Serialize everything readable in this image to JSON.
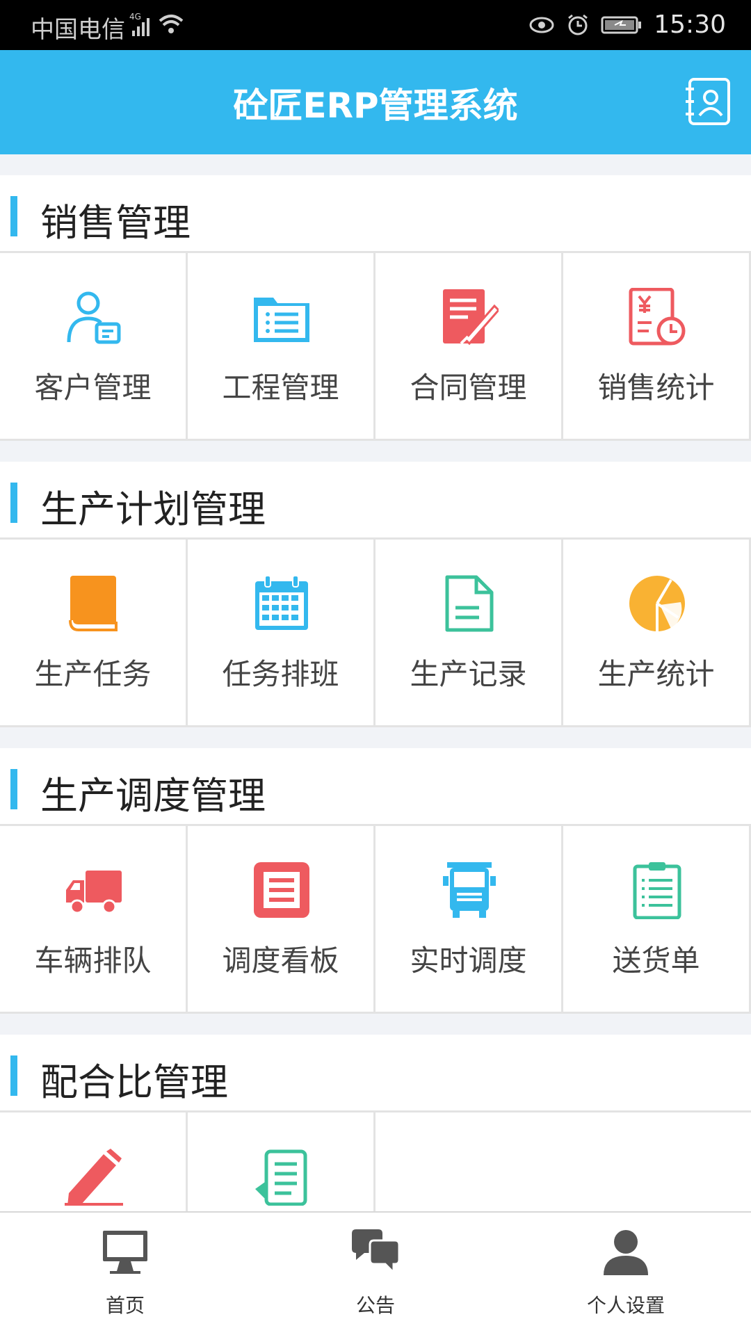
{
  "status_bar": {
    "carrier": "中国电信",
    "network": "4G",
    "time": "15:30"
  },
  "header": {
    "title": "砼匠ERP管理系统",
    "right_icon": "contacts-icon"
  },
  "sections": [
    {
      "title": "销售管理",
      "items": [
        {
          "label": "客户管理",
          "icon": "customer-icon",
          "color": "#33b8ee"
        },
        {
          "label": "工程管理",
          "icon": "folder-list-icon",
          "color": "#33b8ee"
        },
        {
          "label": "合同管理",
          "icon": "contract-pen-icon",
          "color": "#ee5a5f"
        },
        {
          "label": "销售统计",
          "icon": "sales-stats-icon",
          "color": "#ee5a5f"
        }
      ]
    },
    {
      "title": "生产计划管理",
      "items": [
        {
          "label": "生产任务",
          "icon": "book-icon",
          "color": "#f7931e"
        },
        {
          "label": "任务排班",
          "icon": "calendar-icon",
          "color": "#33b8ee"
        },
        {
          "label": "生产记录",
          "icon": "document-icon",
          "color": "#3cc29b"
        },
        {
          "label": "生产统计",
          "icon": "pie-chart-icon",
          "color": "#f9b233"
        }
      ]
    },
    {
      "title": "生产调度管理",
      "items": [
        {
          "label": "车辆排队",
          "icon": "truck-icon",
          "color": "#ee5a5f"
        },
        {
          "label": "调度看板",
          "icon": "board-icon",
          "color": "#ee5a5f"
        },
        {
          "label": "实时调度",
          "icon": "bus-front-icon",
          "color": "#33b8ee"
        },
        {
          "label": "送货单",
          "icon": "clipboard-icon",
          "color": "#3cc29b"
        }
      ]
    },
    {
      "title": "配合比管理",
      "items": [
        {
          "label": "",
          "icon": "pencil-icon",
          "color": "#ee5a5f"
        },
        {
          "label": "",
          "icon": "list-doc-icon",
          "color": "#3cc29b"
        }
      ]
    }
  ],
  "tabs": [
    {
      "label": "首页",
      "icon": "monitor-icon"
    },
    {
      "label": "公告",
      "icon": "chat-bubbles-icon"
    },
    {
      "label": "个人设置",
      "icon": "user-icon"
    }
  ]
}
